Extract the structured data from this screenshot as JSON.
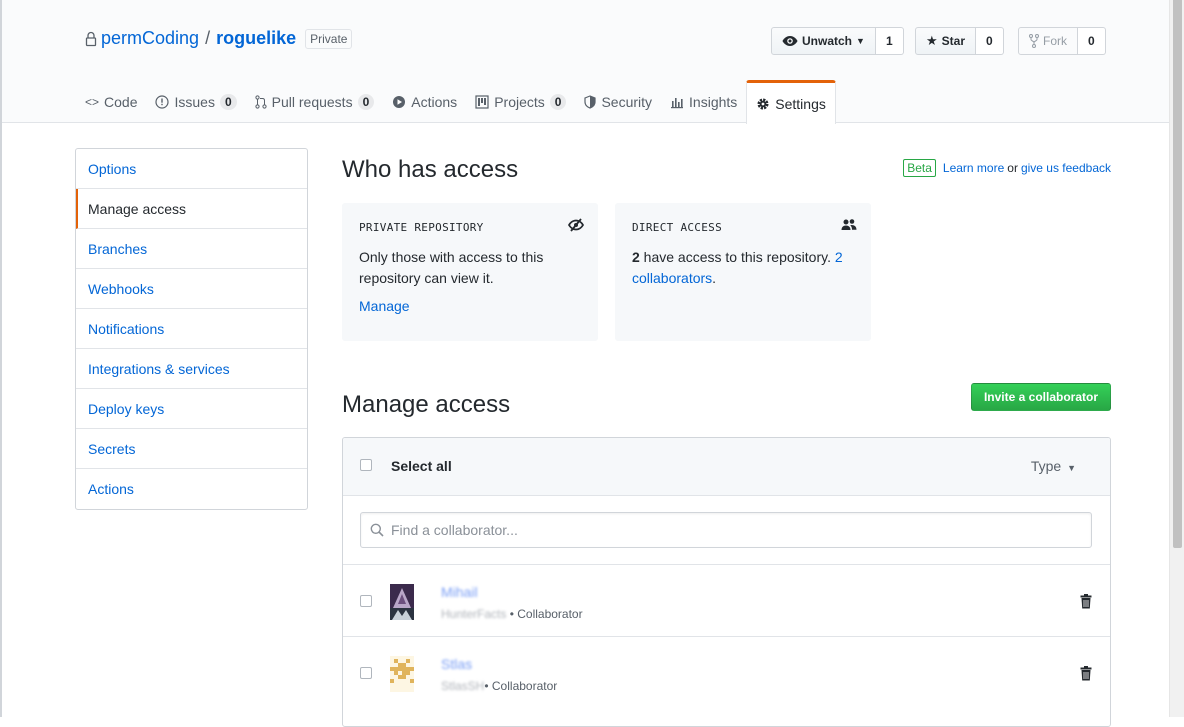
{
  "repo": {
    "owner": "permCoding",
    "separator": "/",
    "name": "roguelike",
    "visibility_label": "Private"
  },
  "actions": {
    "watch": {
      "label": "Unwatch",
      "count": "1"
    },
    "star": {
      "label": "Star",
      "count": "0"
    },
    "fork": {
      "label": "Fork",
      "count": "0"
    }
  },
  "tabs": [
    {
      "label": "Code",
      "counter": ""
    },
    {
      "label": "Issues",
      "counter": "0"
    },
    {
      "label": "Pull requests",
      "counter": "0"
    },
    {
      "label": "Actions",
      "counter": ""
    },
    {
      "label": "Projects",
      "counter": "0"
    },
    {
      "label": "Security",
      "counter": ""
    },
    {
      "label": "Insights",
      "counter": ""
    },
    {
      "label": "Settings",
      "counter": "",
      "selected": true
    }
  ],
  "sidebar": {
    "items": [
      {
        "label": "Options"
      },
      {
        "label": "Manage access",
        "selected": true
      },
      {
        "label": "Branches"
      },
      {
        "label": "Webhooks"
      },
      {
        "label": "Notifications"
      },
      {
        "label": "Integrations & services"
      },
      {
        "label": "Deploy keys"
      },
      {
        "label": "Secrets"
      },
      {
        "label": "Actions"
      }
    ]
  },
  "who_has_access": {
    "title": "Who has access",
    "beta_label": "Beta",
    "learn_more": "Learn more",
    "or_text": "or",
    "feedback": "give us feedback",
    "private_card": {
      "title": "PRIVATE REPOSITORY",
      "description": "Only those with access to this repository can view it.",
      "link": "Manage"
    },
    "direct_card": {
      "title": "DIRECT ACCESS",
      "count_bold": "2",
      "text": " have access to this repository. ",
      "link": "2 collaborators",
      "suffix": "."
    }
  },
  "manage_access": {
    "title": "Manage access",
    "invite_button": "Invite a collaborator",
    "select_all": "Select all",
    "type_filter": "Type",
    "search_placeholder": "Find a collaborator...",
    "collaborators": [
      {
        "name": "Mihail",
        "username": "HunterFacts",
        "role": "• Collaborator"
      },
      {
        "name": "Stlas",
        "username": "StlasSH",
        "role": "• Collaborator"
      }
    ]
  },
  "colors": {
    "accent": "#e36209",
    "link": "#0366d6",
    "primary_button": "#28a745"
  }
}
